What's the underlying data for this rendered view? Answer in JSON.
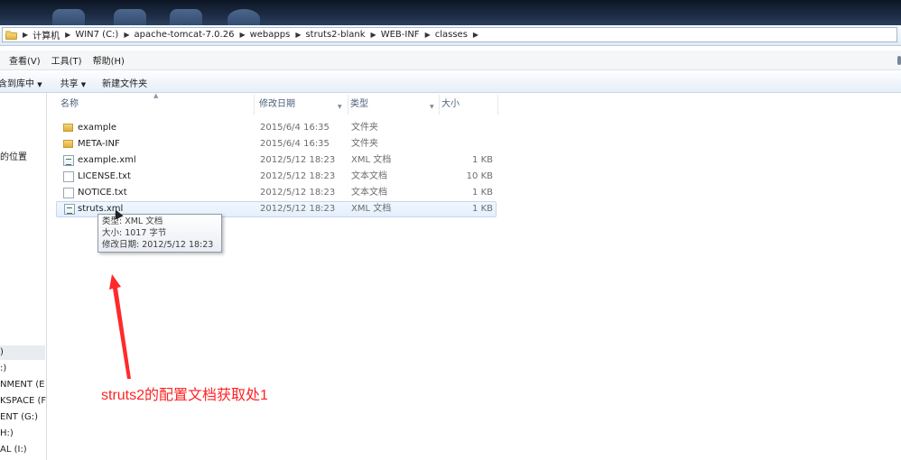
{
  "address_bar": {
    "crumbs": [
      "计算机",
      "WIN7 (C:)",
      "apache-tomcat-7.0.26",
      "webapps",
      "struts2-blank",
      "WEB-INF",
      "classes"
    ]
  },
  "menu": {
    "items": [
      "查看(V)",
      "工具(T)",
      "帮助(H)"
    ]
  },
  "toolbar": {
    "library_label": "含到库中",
    "share_label": "共享",
    "new_folder_label": "新建文件夹"
  },
  "nav_pane": {
    "items": [
      "的位置",
      ")",
      ":)",
      "NMENT (E",
      "KSPACE (F",
      "ENT (G:)",
      "H:)",
      "AL (I:)"
    ]
  },
  "columns": {
    "name": "名称",
    "date": "修改日期",
    "type": "类型",
    "size": "大小"
  },
  "files": [
    {
      "icon": "folder-icon",
      "name": "example",
      "date": "2015/6/4 16:35",
      "type": "文件夹",
      "size": ""
    },
    {
      "icon": "folder-icon",
      "name": "META-INF",
      "date": "2015/6/4 16:35",
      "type": "文件夹",
      "size": ""
    },
    {
      "icon": "xml-file-icon",
      "name": "example.xml",
      "date": "2012/5/12 18:23",
      "type": "XML 文档",
      "size": "1 KB"
    },
    {
      "icon": "text-file-icon",
      "name": "LICENSE.txt",
      "date": "2012/5/12 18:23",
      "type": "文本文档",
      "size": "10 KB"
    },
    {
      "icon": "text-file-icon",
      "name": "NOTICE.txt",
      "date": "2012/5/12 18:23",
      "type": "文本文档",
      "size": "1 KB"
    },
    {
      "icon": "xml-file-icon",
      "name": "struts.xml",
      "date": "2012/5/12 18:23",
      "type": "XML 文档",
      "size": "1 KB"
    }
  ],
  "tooltip": {
    "type_line": "类型: XML 文档",
    "size_line": "大小: 1017 字节",
    "date_line": "修改日期: 2012/5/12 18:23"
  },
  "annotation": {
    "text": "struts2的配置文档获取处1",
    "color": "#ff2222"
  }
}
